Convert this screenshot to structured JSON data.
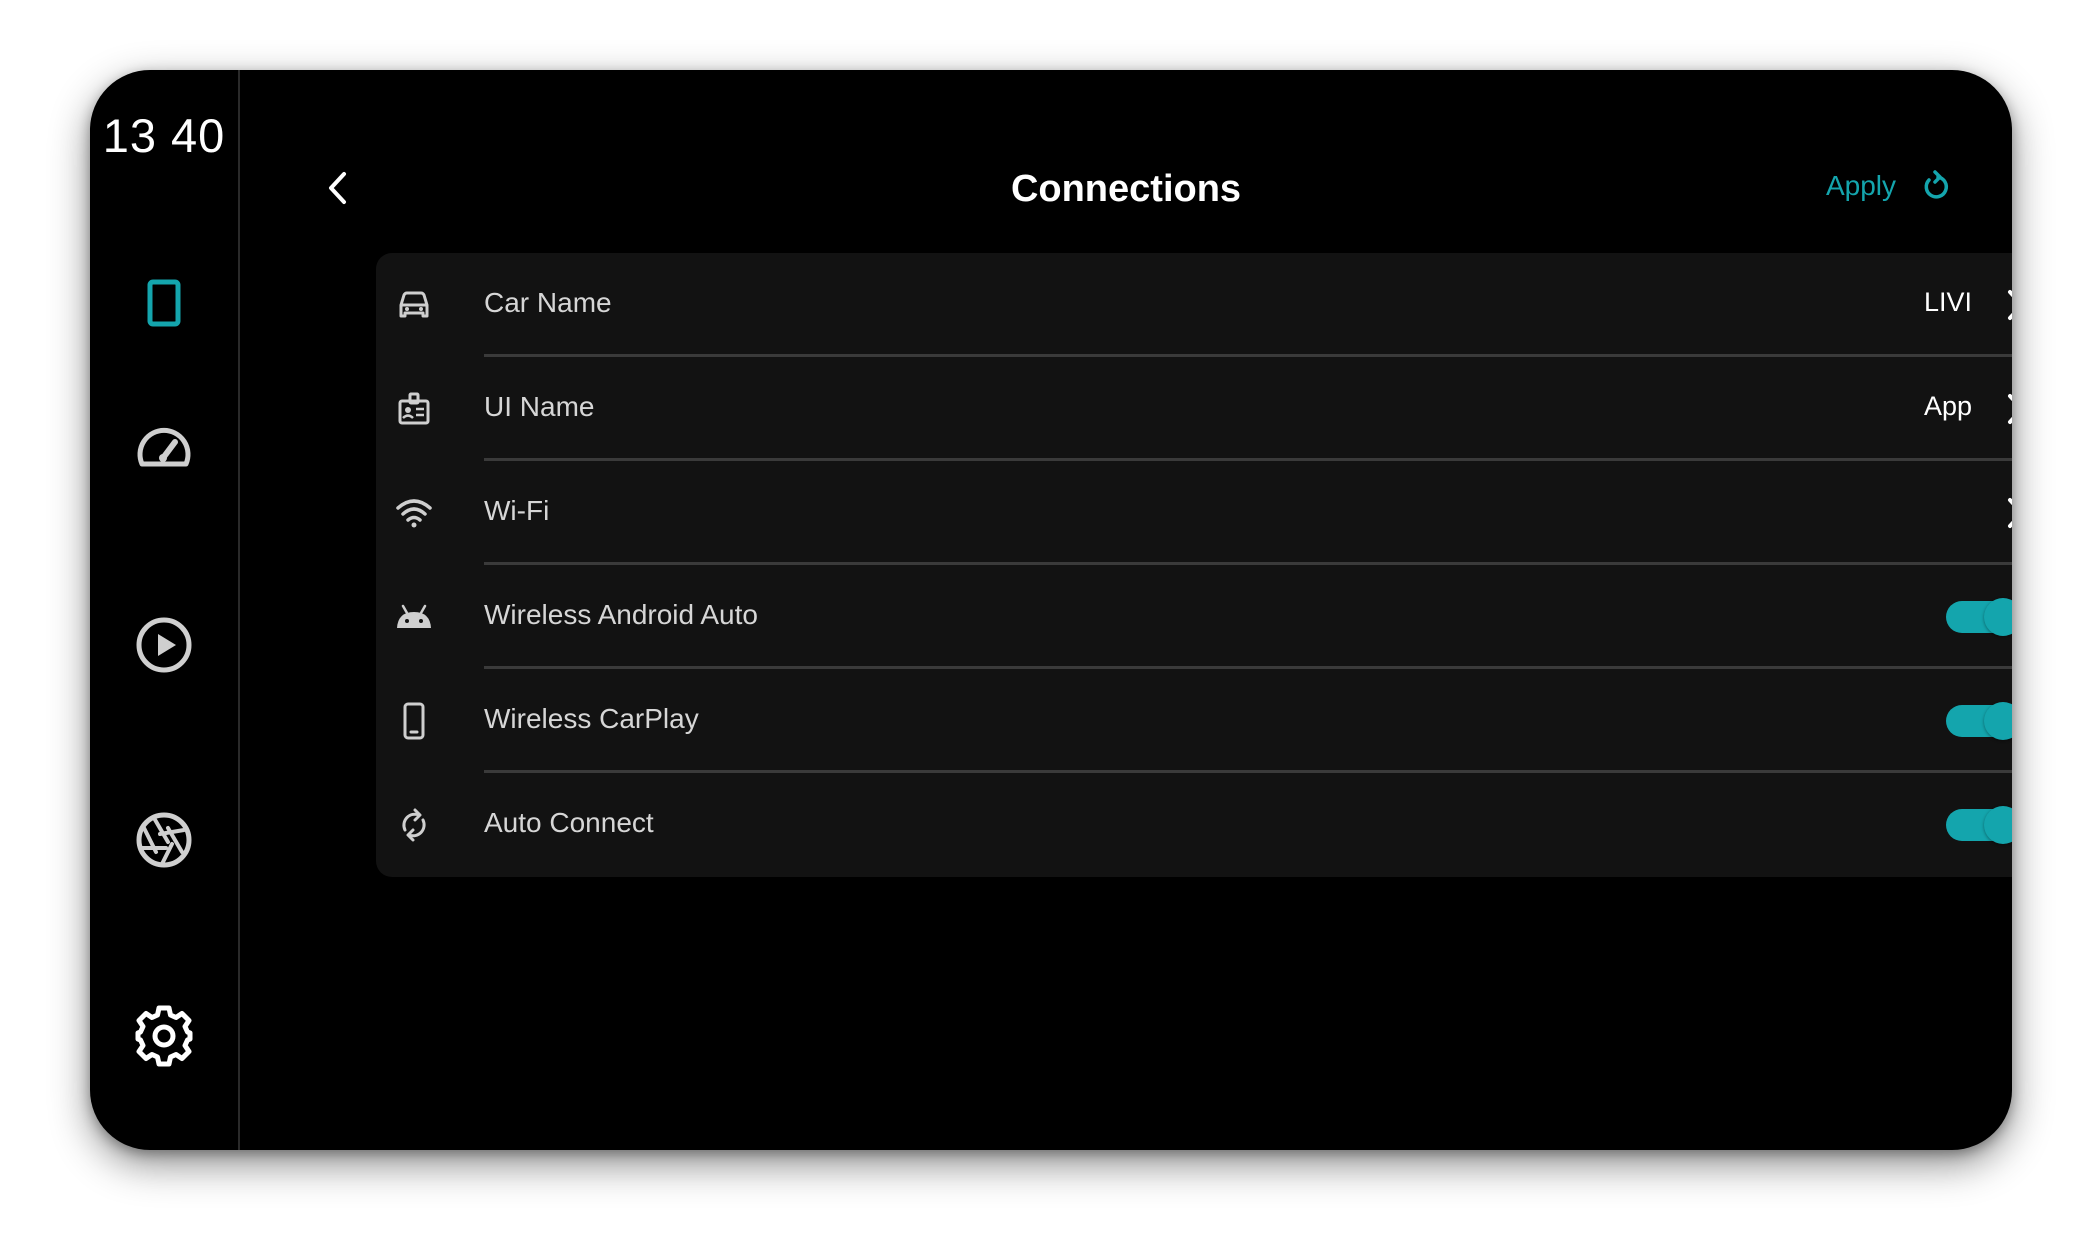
{
  "colors": {
    "accent": "#14a5ad",
    "background": "#000000",
    "panel": "#121212",
    "divider": "#3a3a3a"
  },
  "sidebar": {
    "clock": "13 40",
    "items": [
      {
        "name": "phone-icon",
        "active": true
      },
      {
        "name": "dashboard-gauge-icon",
        "active": false
      },
      {
        "name": "media-play-icon",
        "active": false
      },
      {
        "name": "camera-aperture-icon",
        "active": false
      },
      {
        "name": "settings-gear-icon",
        "active": false
      }
    ]
  },
  "header": {
    "title": "Connections",
    "apply_label": "Apply",
    "back_icon": "chevron-left-icon",
    "apply_icon": "refresh-icon"
  },
  "settings": [
    {
      "label": "Car Name",
      "icon": "car-icon",
      "value": "LIVI",
      "type": "link"
    },
    {
      "label": "UI Name",
      "icon": "badge-icon",
      "value": "App",
      "type": "link"
    },
    {
      "label": "Wi-Fi",
      "icon": "wifi-icon",
      "value": "",
      "type": "link"
    },
    {
      "label": "Wireless Android Auto",
      "icon": "android-icon",
      "type": "toggle",
      "enabled": true
    },
    {
      "label": "Wireless CarPlay",
      "icon": "smartphone-icon",
      "type": "toggle",
      "enabled": true
    },
    {
      "label": "Auto Connect",
      "icon": "sync-icon",
      "type": "toggle",
      "enabled": true
    }
  ]
}
